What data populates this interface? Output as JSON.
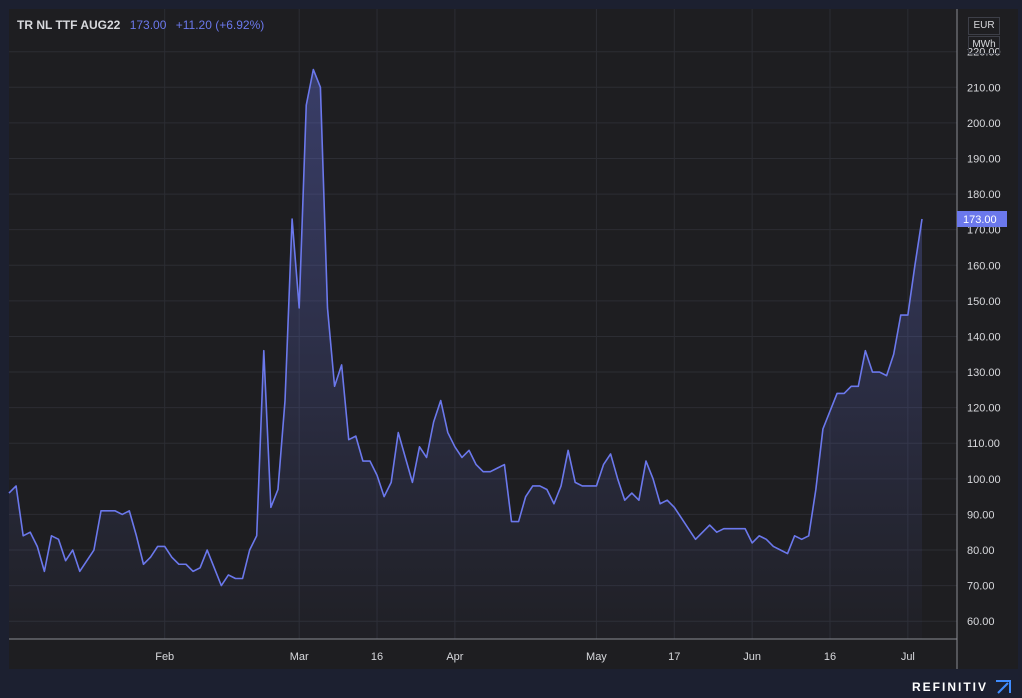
{
  "header": {
    "symbol": "TR NL TTF AUG22",
    "last": "173.00",
    "change": "+11.20 (+6.92%)"
  },
  "units": {
    "currency": "EUR",
    "volume": "MWh"
  },
  "brand": "REFINITIV",
  "colors": {
    "line": "#6b78ec",
    "background": "#1e1e21",
    "grid": "#2c2d33",
    "text": "#d8d9dd"
  },
  "chart_data": {
    "type": "area",
    "title": "",
    "ylim": [
      55,
      232
    ],
    "grid": true,
    "y_ticks": [
      "60.00",
      "70.00",
      "80.00",
      "90.00",
      "100.00",
      "110.00",
      "120.00",
      "130.00",
      "140.00",
      "150.00",
      "160.00",
      "170.00",
      "180.00",
      "190.00",
      "200.00",
      "210.00",
      "220.00"
    ],
    "x_ticks": [
      {
        "label": "Feb",
        "index": 22
      },
      {
        "label": "Mar",
        "index": 41
      },
      {
        "label": "16",
        "index": 52
      },
      {
        "label": "Apr",
        "index": 63
      },
      {
        "label": "May",
        "index": 83
      },
      {
        "label": "17",
        "index": 94
      },
      {
        "label": "Jun",
        "index": 105
      },
      {
        "label": "16",
        "index": 116
      },
      {
        "label": "Jul",
        "index": 127
      }
    ],
    "last_value_label": "173.00",
    "series": [
      {
        "values": [
          96,
          98,
          84,
          85,
          81,
          74,
          84,
          83,
          77,
          80,
          74,
          77,
          80,
          91,
          91,
          91,
          90,
          91,
          84,
          76,
          78,
          81,
          81,
          78,
          76,
          76,
          74,
          75,
          80,
          75,
          70,
          73,
          72,
          72,
          80,
          84,
          136,
          92,
          97,
          122,
          173,
          148,
          205,
          215,
          210,
          148,
          126,
          132,
          111,
          112,
          105,
          105,
          101,
          95,
          99,
          113,
          106,
          99,
          109,
          106,
          116,
          122,
          113,
          109,
          106,
          108,
          104,
          102,
          102,
          103,
          104,
          88,
          88,
          95,
          98,
          98,
          97,
          93,
          98,
          108,
          99,
          98,
          98,
          98,
          104,
          107,
          100,
          94,
          96,
          94,
          105,
          100,
          93,
          94,
          92,
          89,
          86,
          83,
          85,
          87,
          85,
          86,
          86,
          86,
          86,
          82,
          84,
          83,
          81,
          80,
          79,
          84,
          83,
          84,
          97,
          114,
          119,
          124,
          124,
          126,
          126,
          136,
          130,
          130,
          129,
          135,
          146,
          146,
          160,
          173
        ]
      }
    ]
  }
}
